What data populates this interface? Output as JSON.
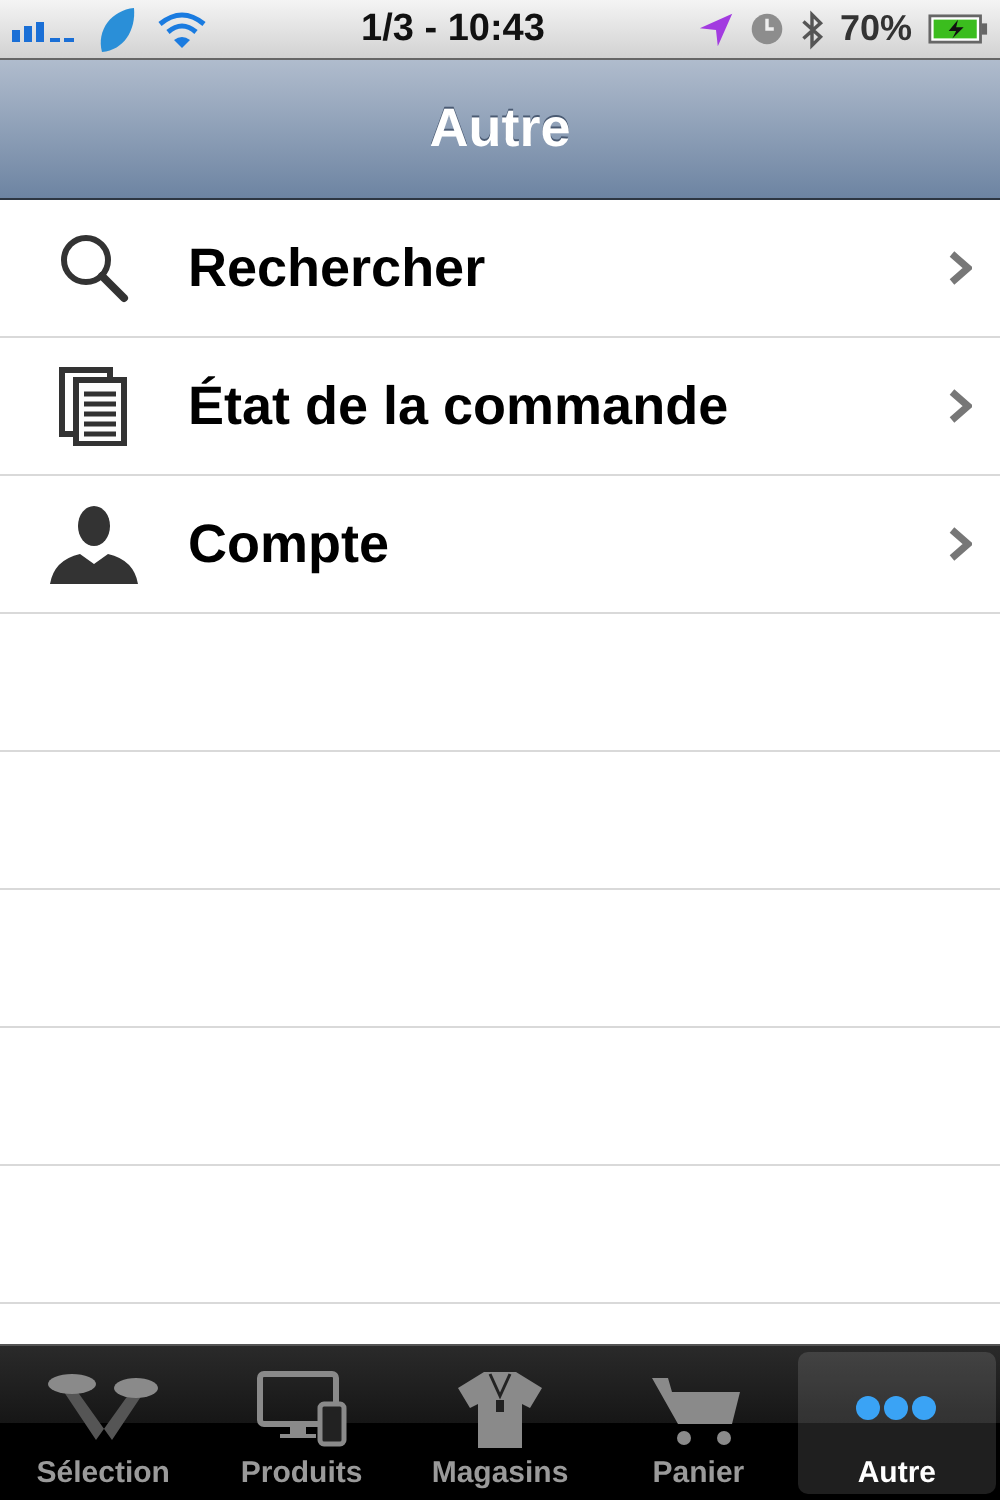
{
  "status_bar": {
    "time": "1/3 - 10:43",
    "battery": "70%"
  },
  "nav_bar": {
    "title": "Autre"
  },
  "items": [
    {
      "label": "Rechercher",
      "kind": "search"
    },
    {
      "label": "État de la commande",
      "kind": "documents"
    },
    {
      "label": "Compte",
      "kind": "person"
    }
  ],
  "tabs": [
    {
      "label": "Sélection",
      "kind": "spotlights",
      "selected": false
    },
    {
      "label": "Produits",
      "kind": "devices",
      "selected": false
    },
    {
      "label": "Magasins",
      "kind": "shirt",
      "selected": false
    },
    {
      "label": "Panier",
      "kind": "cart",
      "selected": false
    },
    {
      "label": "Autre",
      "kind": "more",
      "selected": true
    }
  ]
}
